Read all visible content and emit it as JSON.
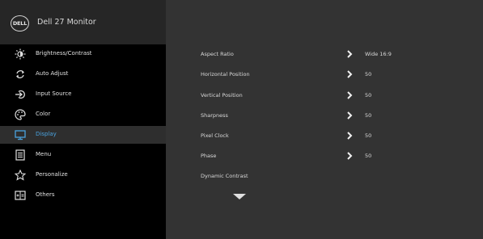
{
  "header": {
    "logo_text": "DELL",
    "model": "Dell 27 Monitor"
  },
  "sidebar": {
    "items": [
      {
        "label": "Brightness/Contrast",
        "icon": "brightness-icon"
      },
      {
        "label": "Auto Adjust",
        "icon": "auto-adjust-icon"
      },
      {
        "label": "Input Source",
        "icon": "input-source-icon"
      },
      {
        "label": "Color",
        "icon": "palette-icon"
      },
      {
        "label": "Display",
        "icon": "monitor-icon",
        "active": true
      },
      {
        "label": "Menu",
        "icon": "menu-icon"
      },
      {
        "label": "Personalize",
        "icon": "star-icon"
      },
      {
        "label": "Others",
        "icon": "others-icon"
      }
    ]
  },
  "display_settings": {
    "rows": [
      {
        "label": "Aspect Ratio",
        "value": "Wide 16:9"
      },
      {
        "label": "Horizontal Position",
        "value": "50"
      },
      {
        "label": "Vertical Position",
        "value": "50"
      },
      {
        "label": "Sharpness",
        "value": "50"
      },
      {
        "label": "Pixel Clock",
        "value": "50"
      },
      {
        "label": "Phase",
        "value": "50"
      },
      {
        "label": "Dynamic Contrast",
        "value": ""
      }
    ]
  },
  "colors": {
    "accent": "#4aa3df",
    "panel_bg": "#333333",
    "sidebar_bg": "#000000",
    "header_bg": "#262626"
  }
}
